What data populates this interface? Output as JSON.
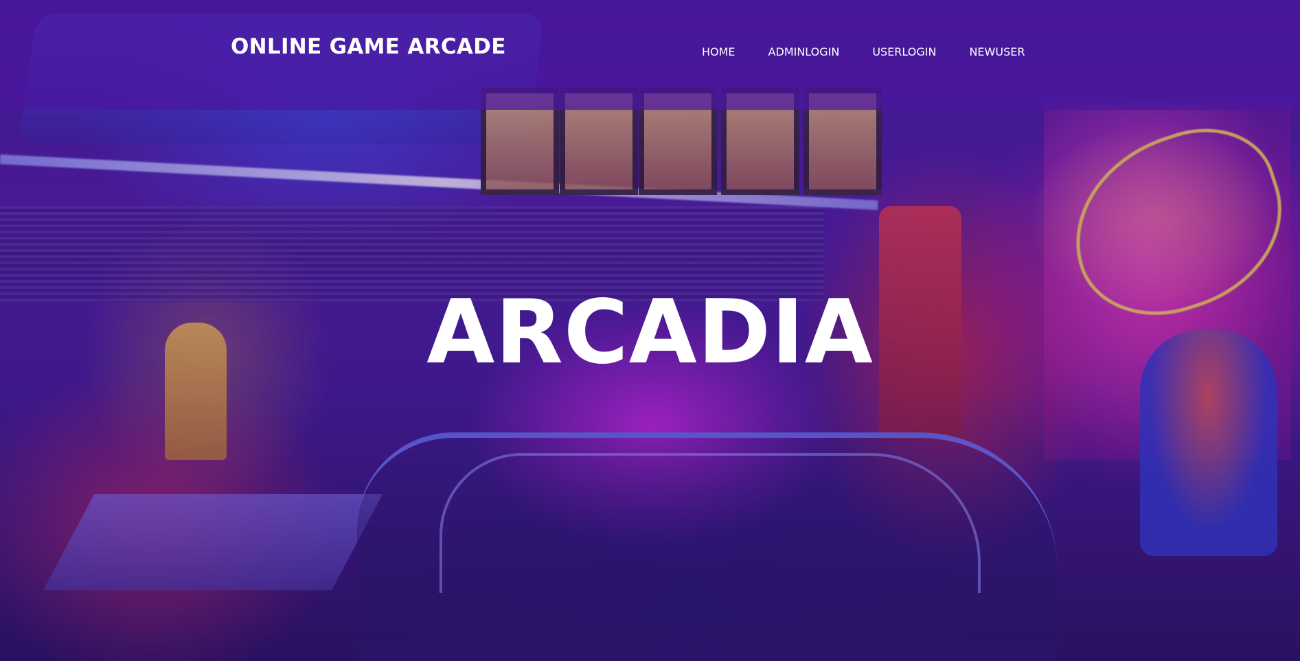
{
  "header": {
    "brand": "ONLINE GAME ARCADE"
  },
  "nav": {
    "items": [
      {
        "label": "HOME"
      },
      {
        "label": "ADMINLOGIN"
      },
      {
        "label": "USERLOGIN"
      },
      {
        "label": "NEWUSER"
      }
    ]
  },
  "hero": {
    "title": "ARCADIA",
    "background": "neon-diner-photo"
  },
  "colors": {
    "header_overlay": "#4b16a0",
    "text": "#ffffff",
    "tint": "#46148c"
  }
}
